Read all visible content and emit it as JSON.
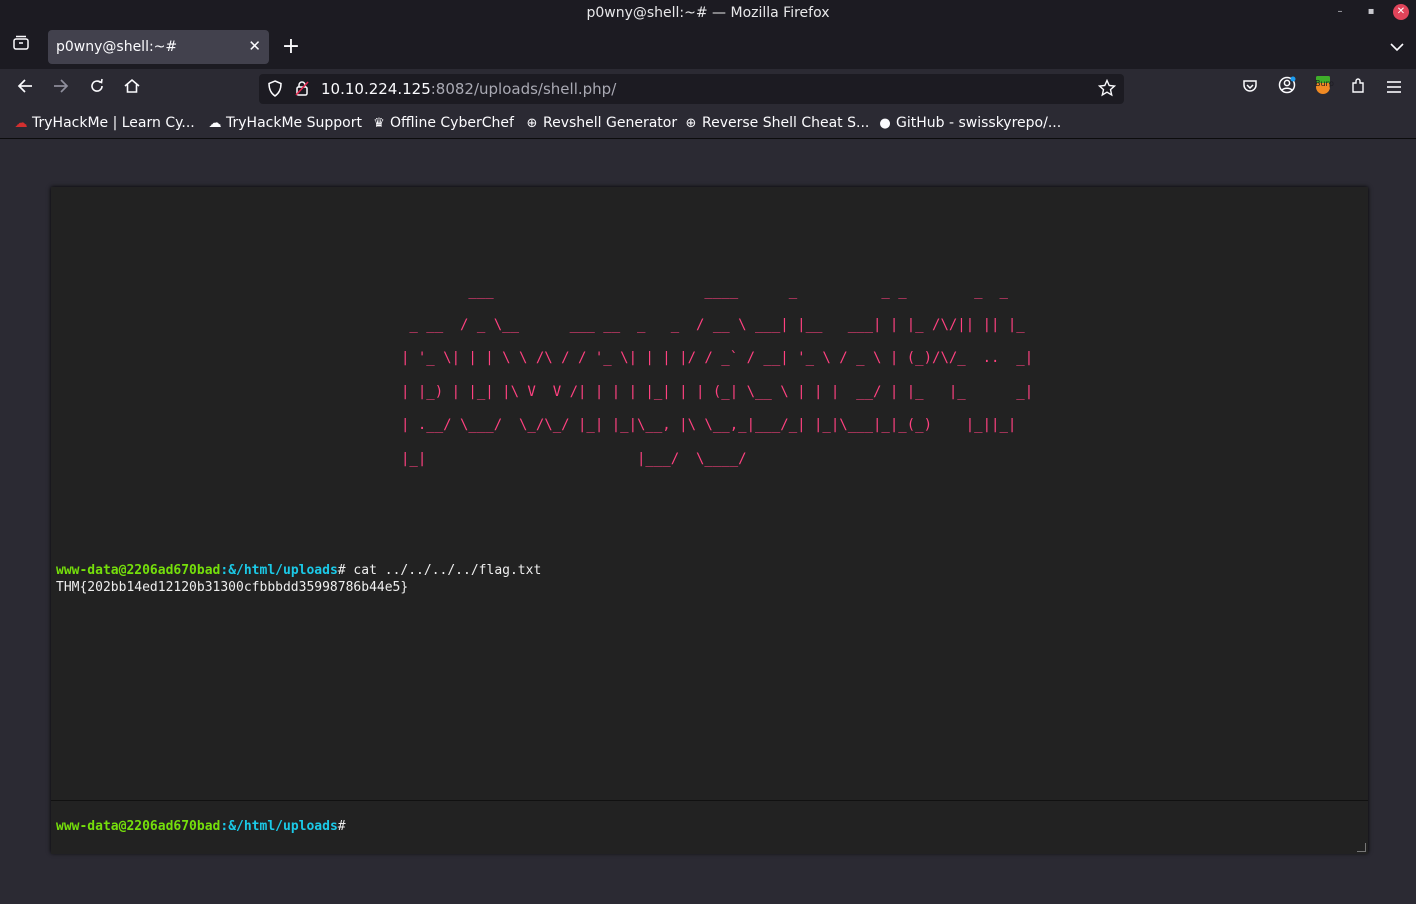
{
  "window": {
    "title": "p0wny@shell:~# — Mozilla Firefox"
  },
  "tab": {
    "label": "p0wny@shell:~#",
    "close": "✕"
  },
  "url": {
    "host": "10.10.224.125",
    "rest": ":8082/uploads/shell.php/"
  },
  "bookmarks": [
    {
      "label": "TryHackMe | Learn Cy...",
      "icon": "tryhackme-icon"
    },
    {
      "label": "TryHackMe Support",
      "icon": "cloud-icon"
    },
    {
      "label": "Offline CyberChef",
      "icon": "chef-icon"
    },
    {
      "label": "Revshell Generator",
      "icon": "globe-icon"
    },
    {
      "label": "Reverse Shell Cheat S...",
      "icon": "globe-icon"
    },
    {
      "label": "GitHub - swisskyrepo/...",
      "icon": "github-icon"
    }
  ],
  "toolbar": {
    "burp_badge": "Burp"
  },
  "shell": {
    "banner": "        ___                         ____      _          _ _        _  _\n _ __  / _ \\__      ___ __  _   _  / __ \\ ___| |__   ___| | |_ /\\/|| || |_\n| '_ \\| | | \\ \\ /\\ / / '_ \\| | | |/ / _` / __| '_ \\ / _ \\ | (_)/\\/_  ..  _|\n| |_) | |_| |\\ V  V /| | | | |_| | | (_| \\__ \\ | | |  __/ | |_   |_      _|\n| .__/ \\___/  \\_/\\_/ |_| |_|\\__, |\\ \\__,_|___/_| |_|\\___|_|_(_)    |_||_|\n|_|                         |___/  \\____/",
    "history": [
      {
        "user": "www-data@2206ad670bad",
        "path": ":&/html/uploads",
        "symbol": "#",
        "command": " cat ../../../../flag.txt",
        "output": "THM{202bb14ed12120b31300cfbbbdd35998786b44e5}"
      }
    ],
    "prompt": {
      "user": "www-data@2206ad670bad",
      "path": ":&/html/uploads",
      "symbol": "#"
    }
  },
  "colors": {
    "prompt_user": "#75df0b",
    "prompt_path": "#1bc9e7",
    "banner": "#ff4180"
  }
}
